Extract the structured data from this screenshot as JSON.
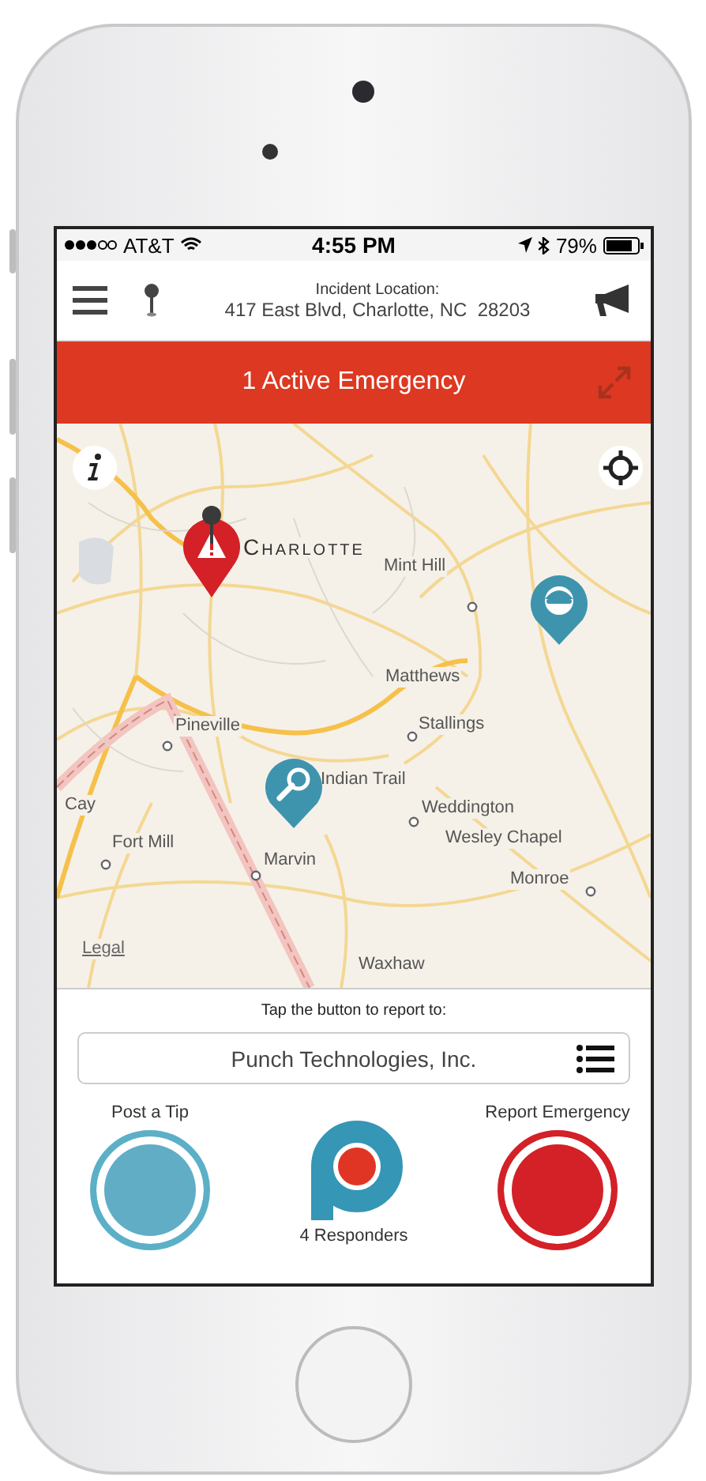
{
  "status_bar": {
    "carrier": "AT&T",
    "time": "4:55 PM",
    "battery": "79%"
  },
  "header": {
    "title": "Incident Location:",
    "address": "417 East Blvd, Charlotte, NC  28203"
  },
  "banner": {
    "text": "1 Active Emergency"
  },
  "map": {
    "labels": [
      {
        "text": "Charlotte",
        "kind": "city"
      },
      {
        "text": "Mint Hill",
        "kind": "town"
      },
      {
        "text": "Matthews",
        "kind": "town"
      },
      {
        "text": "Stallings",
        "kind": "town"
      },
      {
        "text": "Indian Trail",
        "kind": "town"
      },
      {
        "text": "Weddington",
        "kind": "town"
      },
      {
        "text": "Wesley Chapel",
        "kind": "town"
      },
      {
        "text": "Pineville",
        "kind": "town"
      },
      {
        "text": "Cay",
        "kind": "town"
      },
      {
        "text": "Fort Mill",
        "kind": "town"
      },
      {
        "text": "Marvin",
        "kind": "town"
      },
      {
        "text": "Monroe",
        "kind": "town"
      },
      {
        "text": "Waxhaw",
        "kind": "town"
      },
      {
        "text": "Legal",
        "kind": "link"
      }
    ],
    "pins": [
      {
        "kind": "emergency"
      },
      {
        "kind": "responder"
      },
      {
        "kind": "tip"
      }
    ]
  },
  "report": {
    "prompt": "Tap the button to report to:",
    "organization": "Punch Technologies, Inc.",
    "actions": [
      {
        "label": "Post a Tip",
        "kind": "tip"
      },
      {
        "label": "4 Responders",
        "kind": "responders"
      },
      {
        "label": "Report Emergency",
        "kind": "emergency"
      }
    ]
  }
}
